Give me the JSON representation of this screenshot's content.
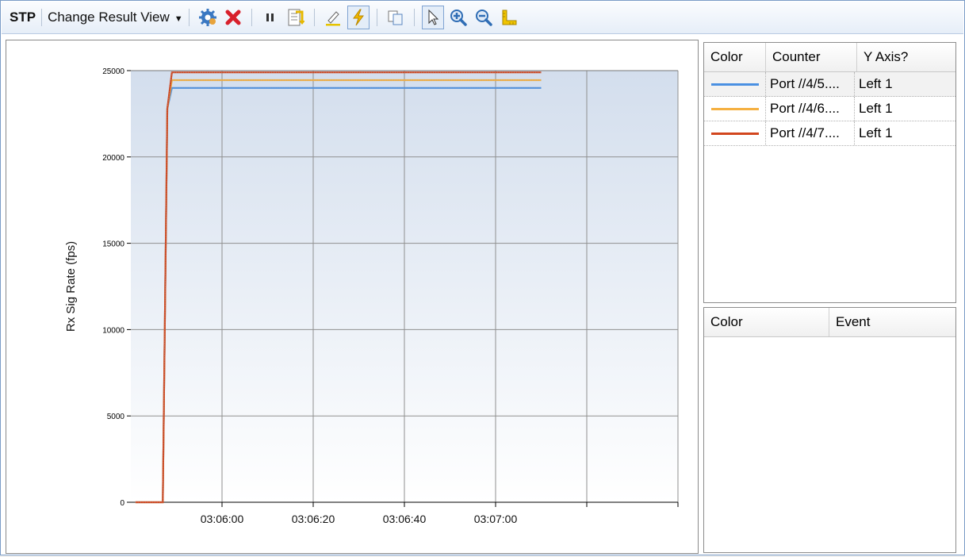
{
  "toolbar": {
    "title": "STP",
    "change_view_label": "Change Result View"
  },
  "counters": {
    "headers": [
      "Color",
      "Counter",
      "Y Axis?"
    ],
    "rows": [
      {
        "color": "#4a90e2",
        "counter": "Port //4/5....",
        "axis": "Left 1"
      },
      {
        "color": "#f5b041",
        "counter": "Port //4/6....",
        "axis": "Left 1"
      },
      {
        "color": "#d2461e",
        "counter": "Port //4/7....",
        "axis": "Left 1"
      }
    ]
  },
  "events": {
    "headers": [
      "Color",
      "Event"
    ]
  },
  "chart_data": {
    "type": "line",
    "ylabel": "Rx Sig Rate (fps)",
    "xlabel": "",
    "ylim": [
      0,
      25000
    ],
    "y_ticks": [
      0,
      5000,
      10000,
      15000,
      20000,
      25000
    ],
    "x_tick_labels": [
      "03:06:00",
      "03:06:20",
      "03:06:40",
      "03:07:00",
      "",
      ""
    ],
    "x_time_range": [
      "03:05:40",
      "03:07:40"
    ],
    "x": [
      "03:05:41",
      "03:05:47",
      "03:05:48",
      "03:05:49",
      "03:07:10"
    ],
    "series": [
      {
        "color": "#4a90e2",
        "values": [
          0,
          0,
          22800,
          24000,
          24000
        ]
      },
      {
        "color": "#f5b041",
        "values": [
          0,
          0,
          22800,
          24450,
          24450
        ]
      },
      {
        "color": "#d2461e",
        "values": [
          0,
          0,
          22800,
          24900,
          24900
        ]
      }
    ],
    "grid": true
  }
}
